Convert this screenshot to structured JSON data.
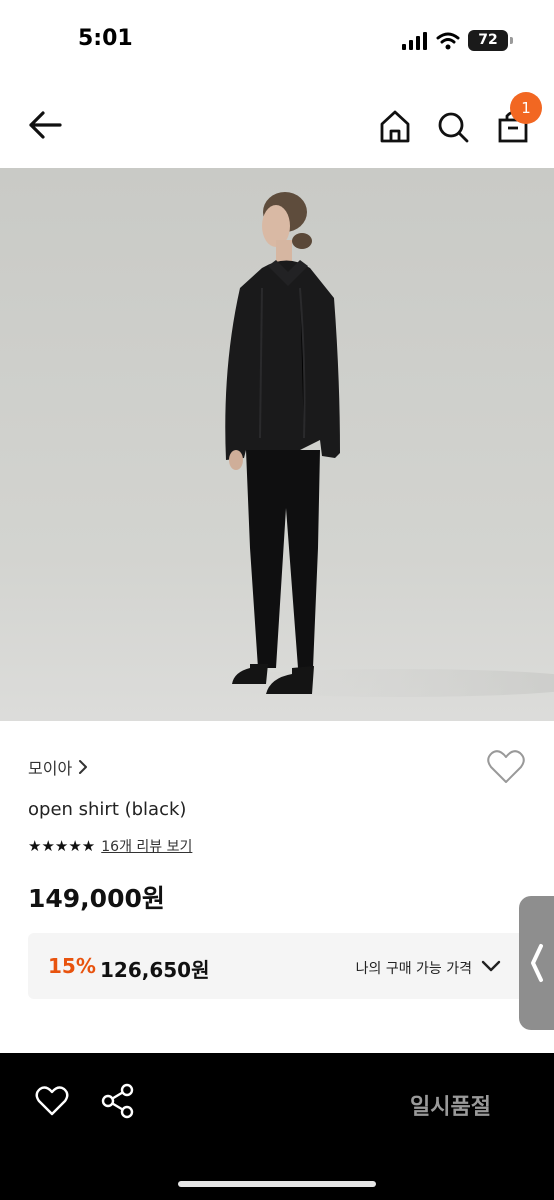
{
  "status_bar": {
    "time": "5:01",
    "battery": "72"
  },
  "header": {
    "cart_count": "1"
  },
  "product": {
    "brand": "모이아",
    "name": "open shirt (black)",
    "stars": "★★★★★",
    "review_link": "16개 리뷰 보기",
    "price": "149,000원",
    "discount_rate": "15%",
    "discount_price": "126,650원",
    "my_price_label": "나의 구매 가능 가격"
  },
  "bottom_bar": {
    "soldout_label": "일시품절"
  },
  "colors": {
    "accent": "#f26722",
    "discount": "#e8530e",
    "bottom_bar": "#000000"
  },
  "icons": [
    "back-arrow-icon",
    "home-icon",
    "search-icon",
    "cart-icon",
    "heart-icon",
    "chevron-right-icon",
    "chevron-down-icon",
    "share-icon"
  ]
}
